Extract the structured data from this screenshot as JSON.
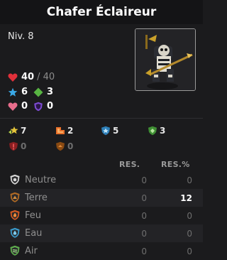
{
  "title": "Chafer Éclaireur",
  "level": "Niv. 8",
  "vitality": {
    "current": "40",
    "max": "/ 40"
  },
  "stats": {
    "ap": "6",
    "mp": "3",
    "pink": "0",
    "purple": "0"
  },
  "secondary": {
    "dodge_ap": "7",
    "dodge_mp": "2",
    "res_blue": "5",
    "res_green": "3",
    "res_red": "0",
    "res_orange": "0"
  },
  "resist_headers": {
    "fixed": "RES.",
    "percent": "RES.%"
  },
  "resistances": [
    {
      "name": "Neutre",
      "fixed": "0",
      "percent": "0",
      "color": "#e0e0e0"
    },
    {
      "name": "Terre",
      "fixed": "0",
      "percent": "12",
      "color": "#c77a2c"
    },
    {
      "name": "Feu",
      "fixed": "0",
      "percent": "0",
      "color": "#e36b2a"
    },
    {
      "name": "Eau",
      "fixed": "0",
      "percent": "0",
      "color": "#4fb3e0"
    },
    {
      "name": "Air",
      "fixed": "0",
      "percent": "0",
      "color": "#7cc66a"
    }
  ]
}
